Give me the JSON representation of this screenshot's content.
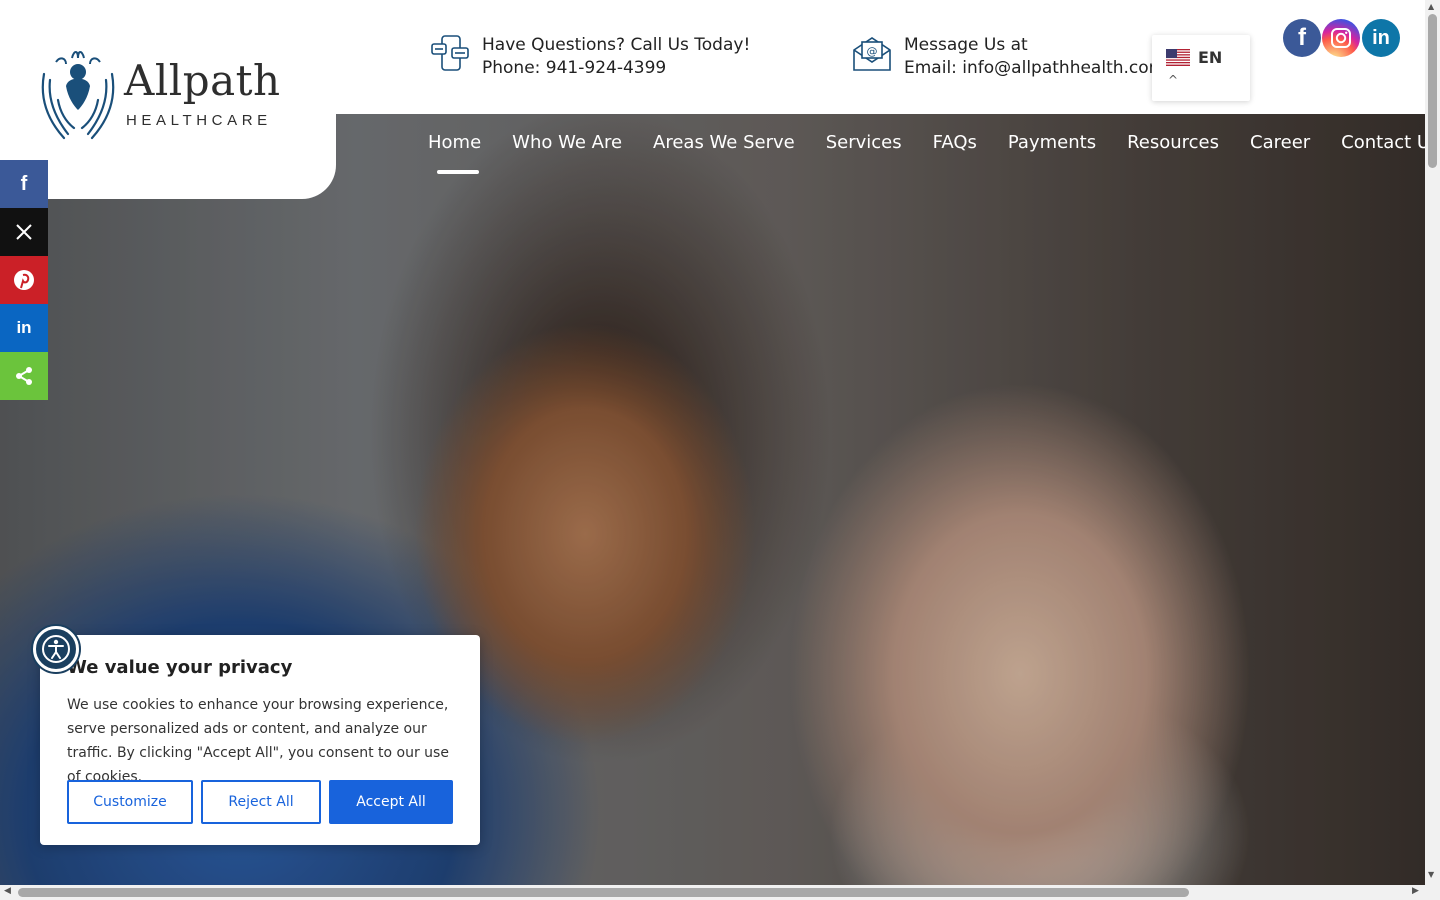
{
  "brand": {
    "name": "Allpath",
    "tagline": "HEALTHCARE"
  },
  "contact": {
    "phone_line1": "Have Questions? Call Us Today!",
    "phone_line2": "Phone: 941-924-4399",
    "email_line1": "Message Us at",
    "email_line2": "Email: info@allpathhealth.com"
  },
  "language": {
    "code": "EN",
    "caret": "^"
  },
  "social_icons": [
    "facebook-icon",
    "instagram-icon",
    "linkedin-icon"
  ],
  "nav": {
    "items": [
      "Home",
      "Who We Are",
      "Areas We Serve",
      "Services",
      "FAQs",
      "Payments",
      "Resources",
      "Career",
      "Contact Us"
    ],
    "active": "Home"
  },
  "share_bar": [
    "facebook",
    "x",
    "pinterest",
    "linkedin",
    "share"
  ],
  "cookie": {
    "title": "We value your privacy",
    "body": "We use cookies to enhance your browsing experience, serve personalized ads or content, and analyze our traffic. By clicking \"Accept All\", you consent to our use of cookies.",
    "customize": "Customize",
    "reject": "Reject All",
    "accept": "Accept All"
  },
  "colors": {
    "primary_blue": "#1863dc",
    "brand_teal": "#1a4f7a",
    "facebook": "#3b5998",
    "pinterest": "#cb2027",
    "linkedin": "#0a66c2",
    "share_green": "#6bc43c"
  }
}
